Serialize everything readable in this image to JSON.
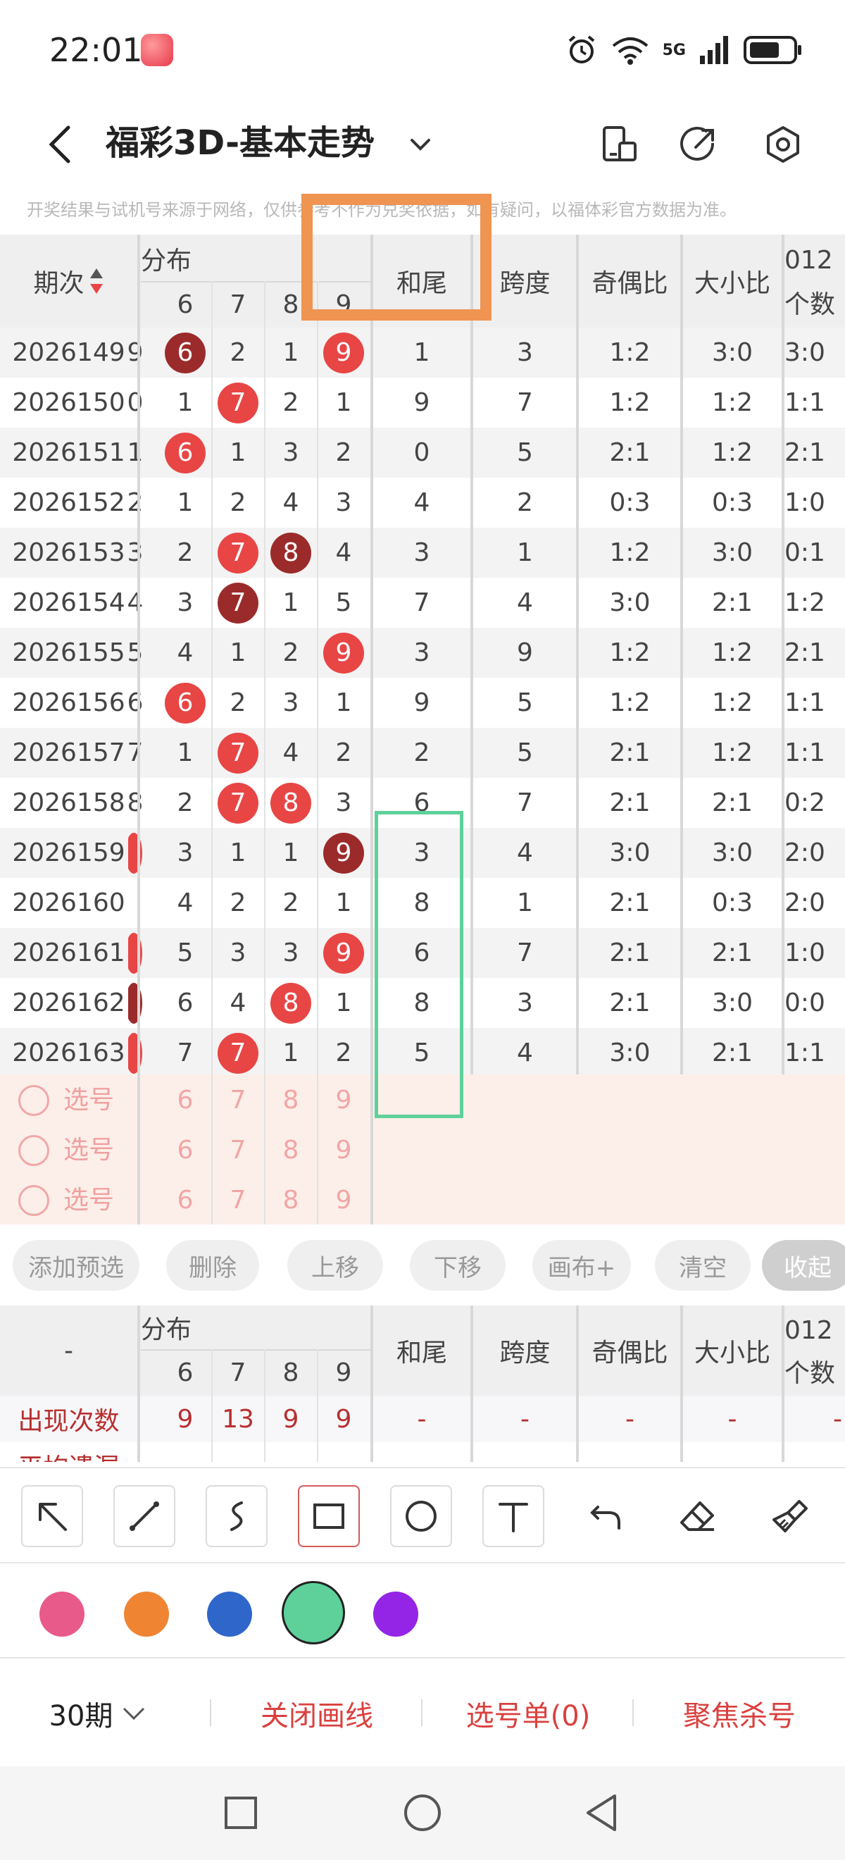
{
  "status_bar": {
    "time": "22:01",
    "network": "5G",
    "battery_percent": 70
  },
  "title_bar": {
    "title": "福彩3D-基本走势"
  },
  "notice": "开奖结果与试机号来源于网络，仅供参考不作为兑奖依据，如有疑问，以福体彩官方数据为准。",
  "table": {
    "headers": {
      "period": "期次",
      "distribution": "分布",
      "digits": [
        "6",
        "7",
        "8",
        "9"
      ],
      "sum_tail": "和尾",
      "span": "跨度",
      "odd_even": "奇偶比",
      "big_small": "大小比",
      "col012_line1": "012",
      "col012_line2": "个数"
    },
    "rows": [
      {
        "period": "2026149",
        "edge": "9",
        "d6": "6",
        "d7": "2",
        "d8": "1",
        "d9": "9",
        "sum_tail": "1",
        "span": "3",
        "odd_even": "1:2",
        "big_small": "3:0",
        "c012": "3:0"
      },
      {
        "period": "2026150",
        "edge": "0",
        "d6": "1",
        "d7": "7",
        "d8": "2",
        "d9": "1",
        "sum_tail": "9",
        "span": "7",
        "odd_even": "1:2",
        "big_small": "1:2",
        "c012": "1:1"
      },
      {
        "period": "2026151",
        "edge": "1",
        "d6": "6",
        "d7": "1",
        "d8": "3",
        "d9": "2",
        "sum_tail": "0",
        "span": "5",
        "odd_even": "2:1",
        "big_small": "1:2",
        "c012": "2:1"
      },
      {
        "period": "2026152",
        "edge": "2",
        "d6": "1",
        "d7": "2",
        "d8": "4",
        "d9": "3",
        "sum_tail": "4",
        "span": "2",
        "odd_even": "0:3",
        "big_small": "0:3",
        "c012": "1:0"
      },
      {
        "period": "2026153",
        "edge": "3",
        "d6": "2",
        "d7": "7",
        "d8": "8",
        "d9": "4",
        "sum_tail": "3",
        "span": "1",
        "odd_even": "1:2",
        "big_small": "3:0",
        "c012": "0:1"
      },
      {
        "period": "2026154",
        "edge": "4",
        "d6": "3",
        "d7": "7",
        "d8": "1",
        "d9": "5",
        "sum_tail": "7",
        "span": "4",
        "odd_even": "3:0",
        "big_small": "2:1",
        "c012": "1:2"
      },
      {
        "period": "2026155",
        "edge": "5",
        "d6": "4",
        "d7": "1",
        "d8": "2",
        "d9": "9",
        "sum_tail": "3",
        "span": "9",
        "odd_even": "1:2",
        "big_small": "1:2",
        "c012": "2:1"
      },
      {
        "period": "2026156",
        "edge": "6",
        "d6": "6",
        "d7": "2",
        "d8": "3",
        "d9": "1",
        "sum_tail": "9",
        "span": "5",
        "odd_even": "1:2",
        "big_small": "1:2",
        "c012": "1:1"
      },
      {
        "period": "2026157",
        "edge": "7",
        "d6": "1",
        "d7": "7",
        "d8": "4",
        "d9": "2",
        "sum_tail": "2",
        "span": "5",
        "odd_even": "2:1",
        "big_small": "1:2",
        "c012": "1:1"
      },
      {
        "period": "2026158",
        "edge": "8",
        "d6": "2",
        "d7": "7",
        "d8": "8",
        "d9": "3",
        "sum_tail": "6",
        "span": "7",
        "odd_even": "2:1",
        "big_small": "2:1",
        "c012": "0:2"
      },
      {
        "period": "2026159",
        "edge": "",
        "d6": "3",
        "d7": "1",
        "d8": "1",
        "d9": "9",
        "sum_tail": "3",
        "span": "4",
        "odd_even": "3:0",
        "big_small": "3:0",
        "c012": "2:0"
      },
      {
        "period": "2026160",
        "edge": "",
        "d6": "4",
        "d7": "2",
        "d8": "2",
        "d9": "1",
        "sum_tail": "8",
        "span": "1",
        "odd_even": "2:1",
        "big_small": "0:3",
        "c012": "2:0"
      },
      {
        "period": "2026161",
        "edge": "",
        "d6": "5",
        "d7": "3",
        "d8": "3",
        "d9": "9",
        "sum_tail": "6",
        "span": "7",
        "odd_even": "2:1",
        "big_small": "2:1",
        "c012": "1:0"
      },
      {
        "period": "2026162",
        "edge": "",
        "d6": "6",
        "d7": "4",
        "d8": "8",
        "d9": "1",
        "sum_tail": "8",
        "span": "3",
        "odd_even": "2:1",
        "big_small": "3:0",
        "c012": "0:0"
      },
      {
        "period": "2026163",
        "edge": "",
        "d6": "7",
        "d7": "7",
        "d8": "1",
        "d9": "2",
        "sum_tail": "5",
        "span": "4",
        "odd_even": "3:0",
        "big_small": "2:1",
        "c012": "1:1"
      }
    ],
    "pick_rows": [
      {
        "label": "选号",
        "nums": [
          "6",
          "7",
          "8",
          "9"
        ]
      },
      {
        "label": "选号",
        "nums": [
          "6",
          "7",
          "8",
          "9"
        ]
      },
      {
        "label": "选号",
        "nums": [
          "6",
          "7",
          "8",
          "9"
        ]
      }
    ]
  },
  "actions": {
    "add_preselect": "添加预选",
    "delete": "删除",
    "move_up": "上移",
    "move_down": "下移",
    "canvas_plus": "画布+",
    "clear": "清空",
    "collapse": "收起"
  },
  "stats": {
    "corner": "-",
    "distribution": "分布",
    "digits": [
      "6",
      "7",
      "8",
      "9"
    ],
    "sum_tail": "和尾",
    "span": "跨度",
    "odd_even": "奇偶比",
    "big_small": "大小比",
    "col012_line1": "012",
    "col012_line2": "个数",
    "occurrence_label": "出现次数",
    "occurrence_values": [
      "9",
      "13",
      "9",
      "9"
    ],
    "dash": "-",
    "avg_miss_label": "平均遗漏"
  },
  "draw_tools": [
    "arrow-tool",
    "line-tool",
    "curve-tool",
    "rectangle-tool",
    "circle-tool",
    "text-tool",
    "undo-tool",
    "eraser-tool",
    "clear-brush-tool"
  ],
  "palette": {
    "pink": "#e85a8a",
    "orange": "#ef8533",
    "blue": "#2f66c9",
    "green": "#5ed19b",
    "purple": "#9424e6",
    "selected": "green"
  },
  "bottom_bar": {
    "periods": "30期",
    "close_drawing": "关闭画线",
    "pick_list": "选号单(0)",
    "focus_kill": "聚焦杀号",
    "accent": "#d9413f"
  }
}
